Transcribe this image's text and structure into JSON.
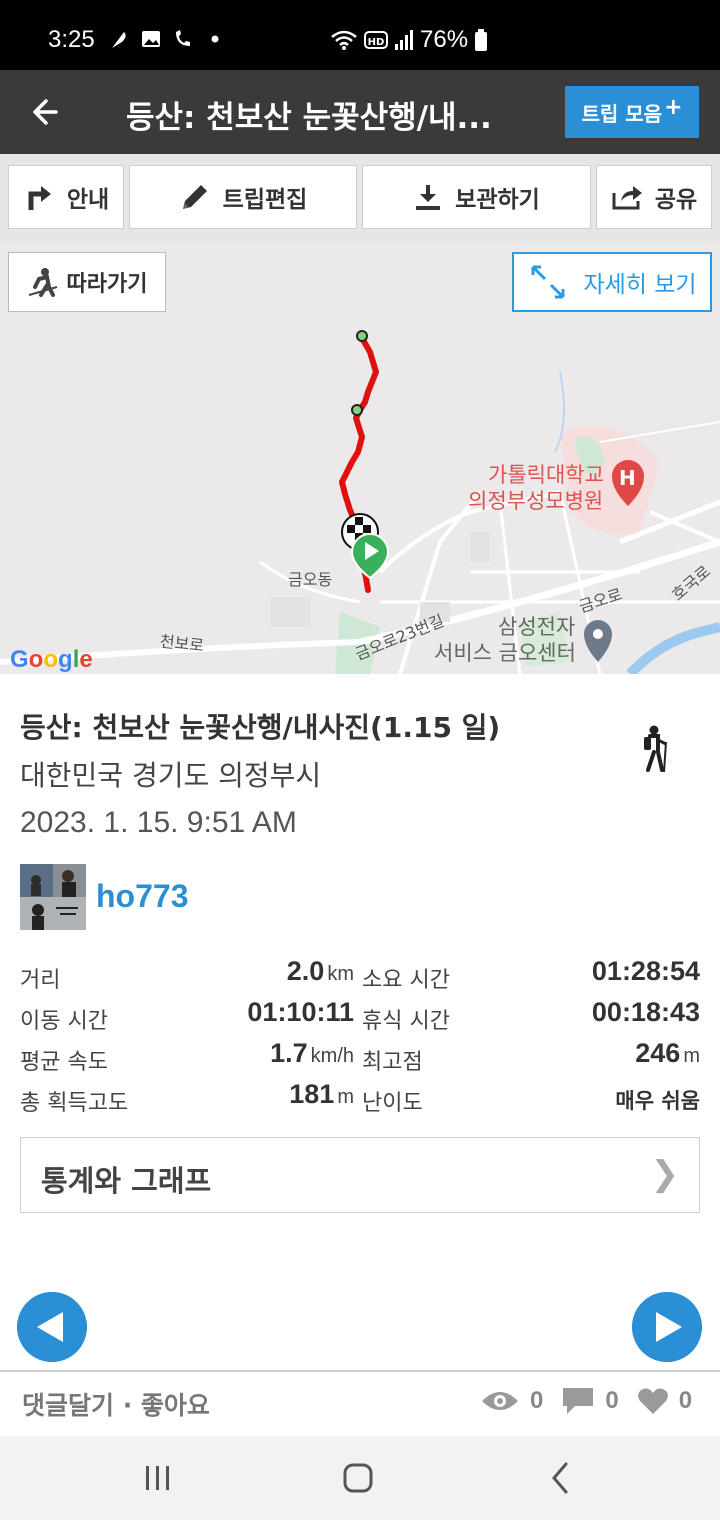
{
  "status_bar": {
    "time": "3:25",
    "battery": "76%",
    "icons": [
      "feather-icon",
      "image-icon",
      "wifi-call-icon",
      "dot-icon",
      "wifi-icon",
      "hd-icon",
      "signal-icon",
      "battery-icon"
    ]
  },
  "app_bar": {
    "title": "등산: 천보산 눈꽃산행/내...",
    "trip_button": "트립 모음",
    "trip_button_plus": "+"
  },
  "toolbar": {
    "guide": "안내",
    "edit_trip": "트립편집",
    "save": "보관하기",
    "share": "공유"
  },
  "map": {
    "follow_button": "따라가기",
    "detail_button": "자세히 보기",
    "labels": {
      "hospital_line1": "가톨릭대학교",
      "hospital_line2": "의정부성모병원",
      "hospital_marker": "H",
      "geumo_dong": "금오동",
      "cheonbo_ro": "천보로",
      "geumo_ro_23": "금오로23번길",
      "geumo_ro": "금오로",
      "hoguk_ro": "호국로",
      "samsung_line1": "삼성전자",
      "samsung_line2": "서비스 금오센터"
    },
    "google_logo": "Google",
    "colors": {
      "route": "#e01010",
      "accent": "#2b9ae0"
    }
  },
  "trip": {
    "title": "등산: 천보산 눈꽃산행/내사진(1.15 일)",
    "location": "대한민국 경기도 의정부시",
    "datetime": "2023. 1. 15. 9:51 AM",
    "username": "ho773",
    "activity_icon": "hiker-icon"
  },
  "stats": [
    {
      "label": "거리",
      "value": "2.0",
      "unit": "km",
      "label2": "소요 시간",
      "value2": "01:28:54",
      "unit2": ""
    },
    {
      "label": "이동 시간",
      "value": "01:10:11",
      "unit": "",
      "label2": "휴식 시간",
      "value2": "00:18:43",
      "unit2": ""
    },
    {
      "label": "평균 속도",
      "value": "1.7",
      "unit": "km/h",
      "label2": "최고점",
      "value2": "246",
      "unit2": "m"
    },
    {
      "label": "총 획득고도",
      "value": "181",
      "unit": "m",
      "label2": "난이도",
      "value2": "매우 쉬움",
      "unit2": ""
    }
  ],
  "graph_button": {
    "label": "통계와 그래프",
    "chevron": "❯"
  },
  "footer": {
    "comment_like": "댓글달기 · 좋아요",
    "views": "0",
    "comments": "0",
    "likes": "0"
  }
}
